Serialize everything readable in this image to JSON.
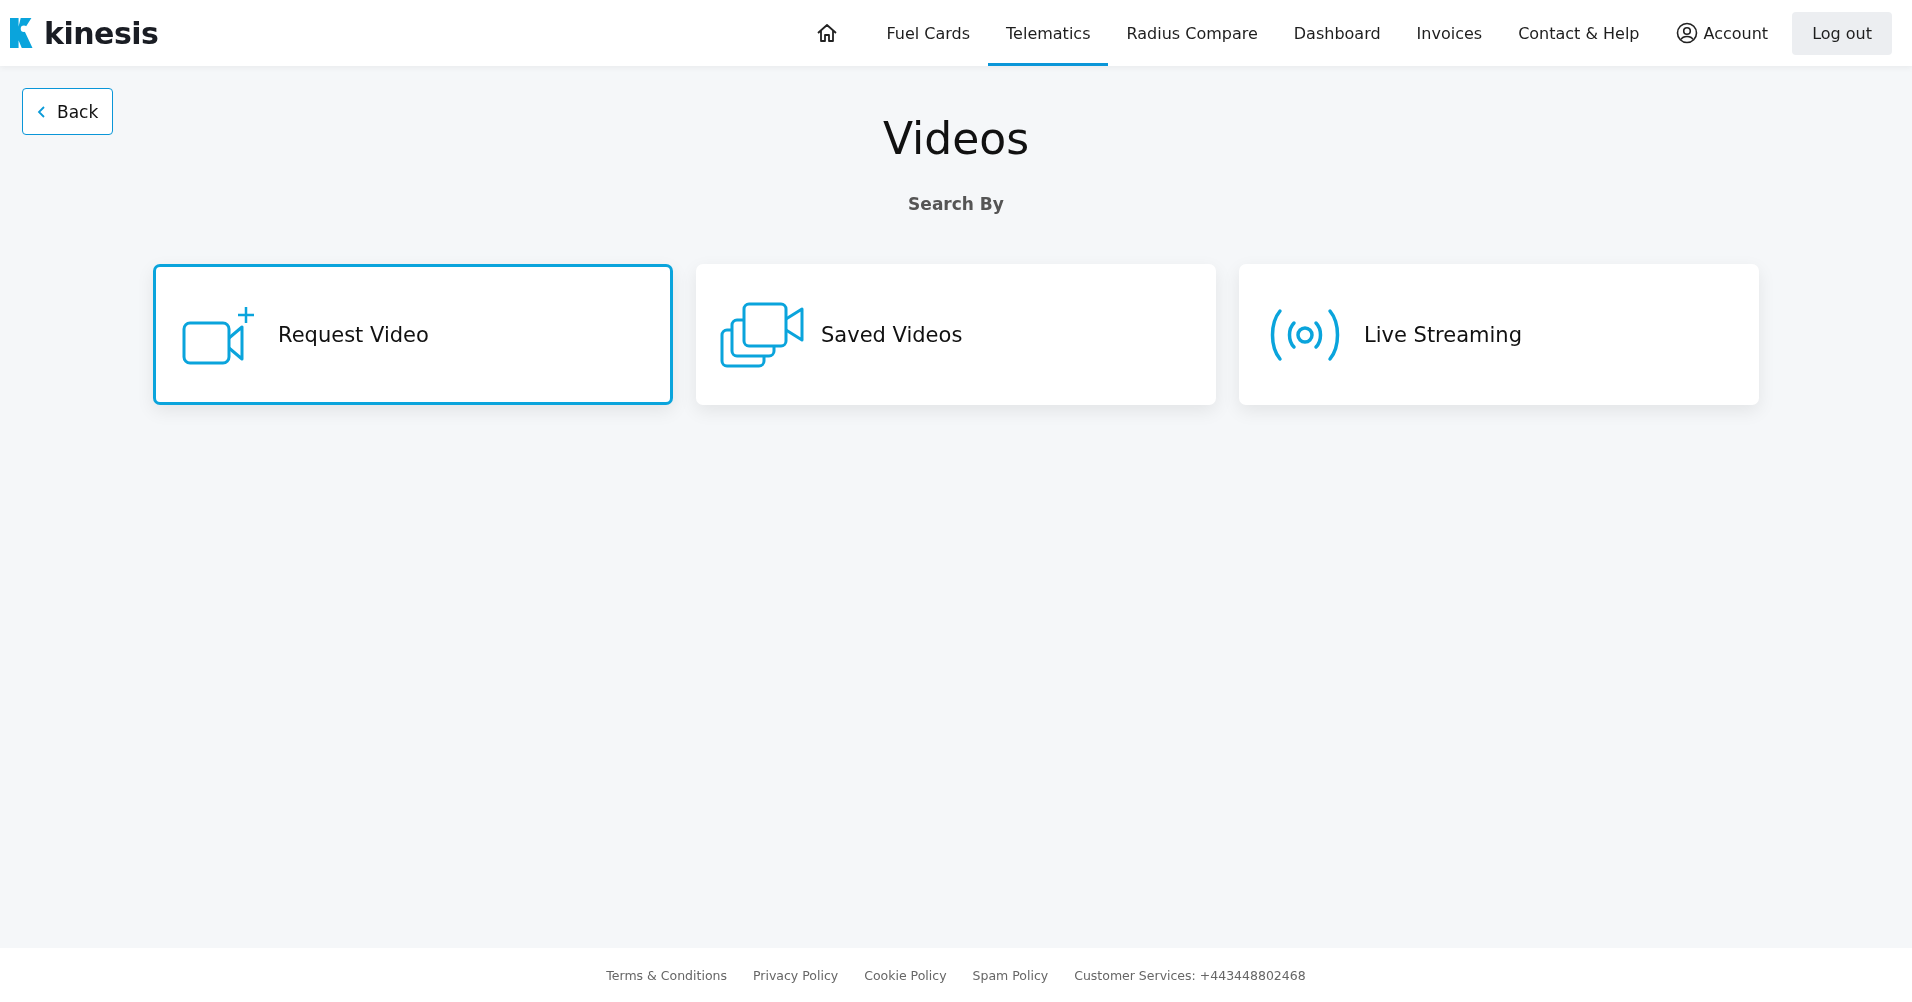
{
  "header": {
    "logo": "kinesis",
    "nav": [
      {
        "label": "Fuel Cards",
        "selected": false
      },
      {
        "label": "Telematics",
        "selected": true
      },
      {
        "label": "Radius Compare",
        "selected": false
      },
      {
        "label": "Dashboard",
        "selected": false
      },
      {
        "label": "Invoices",
        "selected": false
      },
      {
        "label": "Contact & Help",
        "selected": false
      }
    ],
    "account": "Account",
    "logout": "Log out"
  },
  "back": "Back",
  "title": "Videos",
  "subtitle": "Search By",
  "cards": [
    {
      "label": "Request Video",
      "selected": true
    },
    {
      "label": "Saved Videos",
      "selected": false
    },
    {
      "label": "Live Streaming",
      "selected": false
    }
  ],
  "footer": [
    "Terms & Conditions",
    "Privacy Policy",
    "Cookie Policy",
    "Spam Policy",
    "Customer Services: +443448802468"
  ]
}
